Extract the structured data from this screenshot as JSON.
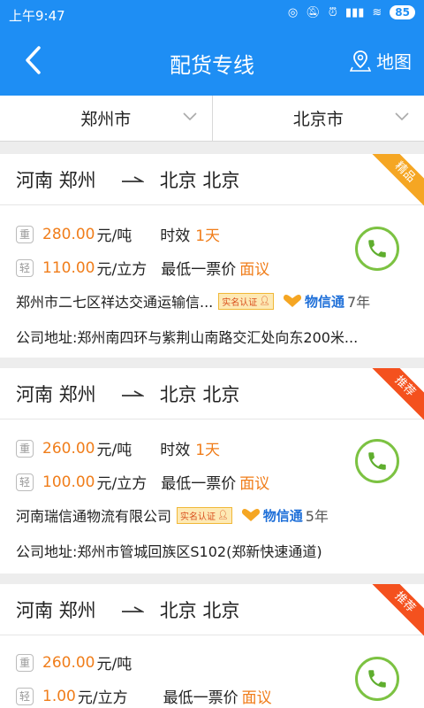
{
  "status": {
    "time": "上午9:47",
    "battery": "85"
  },
  "header": {
    "title": "配货专线",
    "map_label": "地图"
  },
  "filters": {
    "from": "郑州市",
    "to": "北京市"
  },
  "labels": {
    "heavy": "重",
    "light": "轻",
    "per_ton": "元/吨",
    "per_cubic": "元/立方",
    "timeliness": "时效",
    "min_ticket": "最低一票价",
    "negotiable": "面议",
    "verified": "实名认证",
    "xintong": "物信通"
  },
  "cards": [
    {
      "from": "河南 郑州",
      "to": "北京 北京",
      "badge": "精品",
      "heavy_price": "280.00",
      "time_value": "1天",
      "light_price": "110.00",
      "company": "郑州市二七区祥达交通运输信...",
      "years": "7年",
      "address": "公司地址:郑州南四环与紫荆山南路交汇处向东200米..."
    },
    {
      "from": "河南 郑州",
      "to": "北京 北京",
      "badge": "推荐",
      "heavy_price": "260.00",
      "time_value": "1天",
      "light_price": "100.00",
      "company": "河南瑞信通物流有限公司",
      "years": "5年",
      "address": "公司地址:郑州市管城回族区S102(郑新快速通道)"
    },
    {
      "from": "河南 郑州",
      "to": "北京 北京",
      "badge": "推荐",
      "heavy_price": "260.00",
      "light_price": "1.00"
    }
  ]
}
